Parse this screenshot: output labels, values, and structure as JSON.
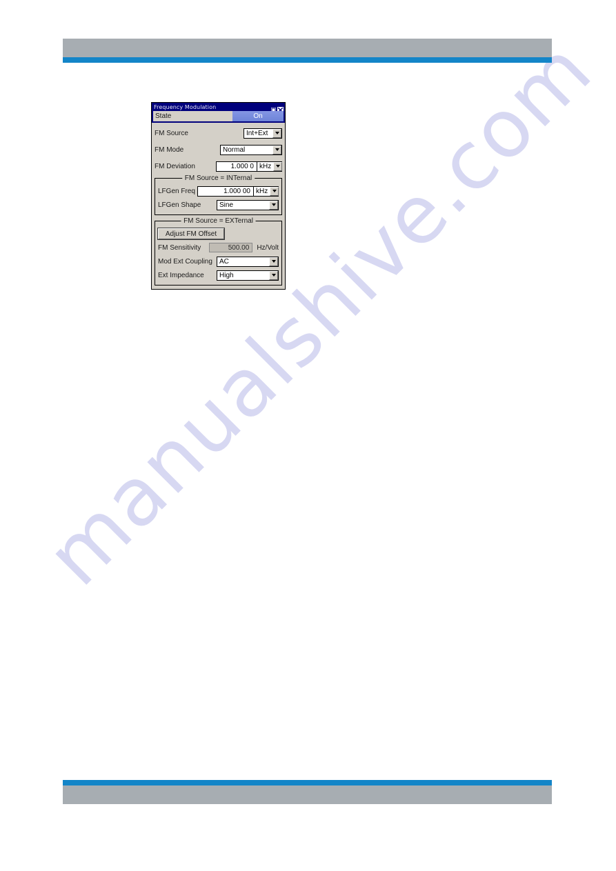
{
  "page": {
    "watermark": "manualshive.com",
    "header": {
      "bar_color": "#a7adb2",
      "rule_color": "#1385c8"
    },
    "footer": {
      "bar_color": "#a7adb2",
      "rule_color": "#1385c8"
    }
  },
  "dialog": {
    "title": "Frequency Modulation",
    "titlebar_color": "#00007c",
    "face_color": "#d4d0c8",
    "buttons": {
      "maximize_icon": "maximize-icon",
      "close_icon": "close-icon"
    },
    "state": {
      "label": "State",
      "value": "On",
      "accent_color": "#7f92e0"
    },
    "fields": [
      {
        "label": "FM Source",
        "value": "Int+Ext",
        "kind": "combo"
      },
      {
        "label": "FM Mode",
        "value": "Normal",
        "kind": "combo"
      },
      {
        "label": "FM Deviation",
        "value": "1.000 0",
        "unit": "kHz",
        "kind": "numeric-unit"
      }
    ],
    "internal_group": {
      "title": "FM Source = INTernal",
      "fields": [
        {
          "label": "LFGen Freq",
          "value": "1.000 00",
          "unit": "kHz",
          "kind": "numeric-unit"
        },
        {
          "label": "LFGen Shape",
          "value": "Sine",
          "kind": "combo"
        }
      ]
    },
    "external_group": {
      "title": "FM Source = EXTernal",
      "button": "Adjust FM Offset",
      "sensitivity": {
        "label": "FM Sensitivity",
        "value": "500.00",
        "unit": "Hz/Volt",
        "readonly": true
      },
      "fields": [
        {
          "label": "Mod Ext Coupling",
          "value": "AC",
          "kind": "combo"
        },
        {
          "label": "Ext Impedance",
          "value": "High",
          "kind": "combo"
        }
      ]
    }
  }
}
